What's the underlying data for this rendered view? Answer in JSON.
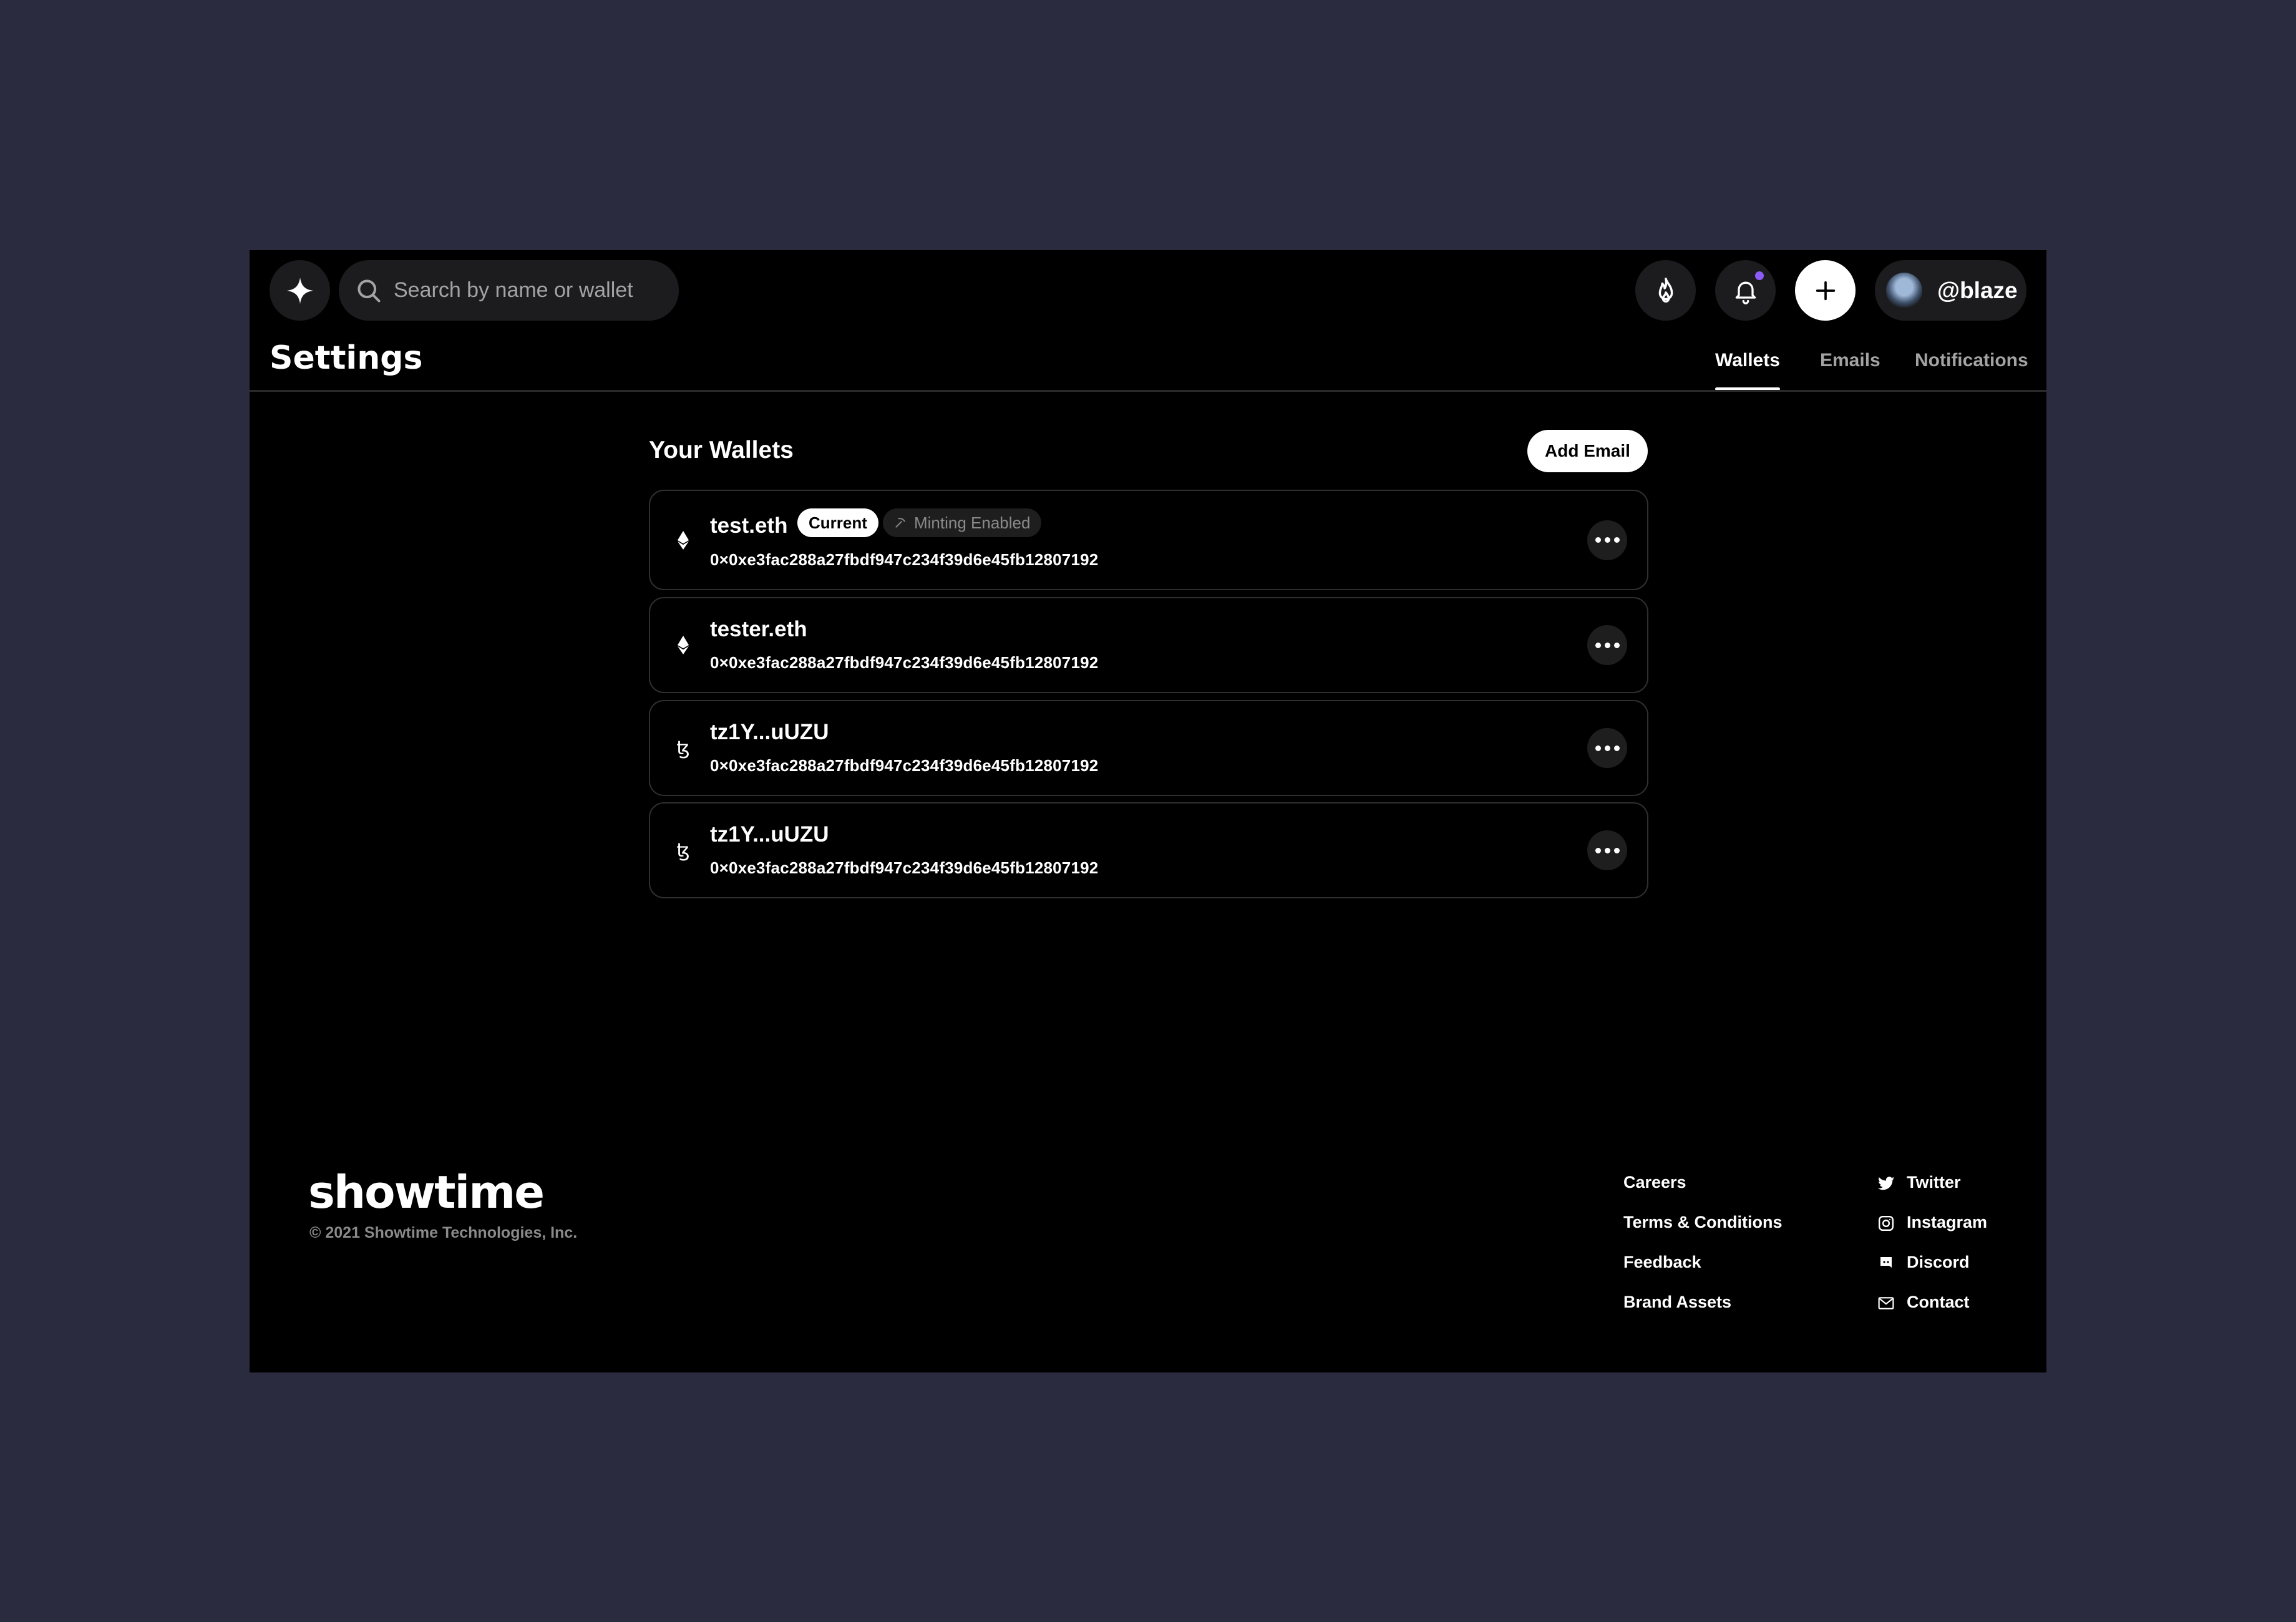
{
  "header": {
    "logo_icon": "sparkle-icon",
    "search_placeholder": "Search by name or wallet",
    "username": "@blaze"
  },
  "page": {
    "title": "Settings",
    "tabs": [
      {
        "label": "Wallets",
        "active": true
      },
      {
        "label": "Emails",
        "active": false
      },
      {
        "label": "Notifications",
        "active": false
      }
    ]
  },
  "wallets": {
    "title": "Your Wallets",
    "add_button": "Add Email",
    "items": [
      {
        "chain": "ethereum",
        "name": "test.eth",
        "address": "0×0xe3fac288a27fbdf947c234f39d6e45fb12807192",
        "badge_current": "Current",
        "badge_minting": "Minting Enabled"
      },
      {
        "chain": "ethereum",
        "name": "tester.eth",
        "address": "0×0xe3fac288a27fbdf947c234f39d6e45fb12807192"
      },
      {
        "chain": "tezos",
        "name": "tz1Y...uUZU",
        "address": "0×0xe3fac288a27fbdf947c234f39d6e45fb12807192"
      },
      {
        "chain": "tezos",
        "name": "tz1Y...uUZU",
        "address": "0×0xe3fac288a27fbdf947c234f39d6e45fb12807192"
      }
    ]
  },
  "footer": {
    "brand": "showtime",
    "copyright": "© 2021 Showtime Technologies, Inc.",
    "links": [
      "Careers",
      "Terms & Conditions",
      "Feedback",
      "Brand Assets"
    ],
    "social": [
      {
        "label": "Twitter",
        "icon": "twitter-icon"
      },
      {
        "label": "Instagram",
        "icon": "instagram-icon"
      },
      {
        "label": "Discord",
        "icon": "discord-icon"
      },
      {
        "label": "Contact",
        "icon": "mail-icon"
      }
    ]
  },
  "colors": {
    "page_bg": "#2b2b3f",
    "app_bg": "#000000",
    "accent_dot": "#8b5cf6"
  }
}
